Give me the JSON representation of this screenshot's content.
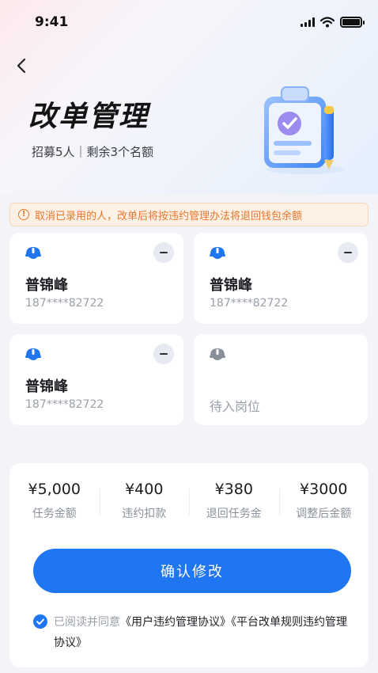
{
  "status_bar": {
    "time": "9:41"
  },
  "header": {
    "title": "改单管理",
    "subtitle": "招募5人｜剩余3个名额"
  },
  "notice": {
    "icon": "info-icon",
    "text": "取消已录用的人，改单后将按违约管理办法将退回钱包余额",
    "color": "#e8772e"
  },
  "workers": [
    {
      "name": "普锦峰",
      "phone": "187****82722",
      "icon": "helmet-icon"
    },
    {
      "name": "普锦峰",
      "phone": "187****82722",
      "icon": "helmet-icon"
    },
    {
      "name": "普锦峰",
      "phone": "187****82722",
      "icon": "helmet-icon"
    }
  ],
  "pending_slot": {
    "text": "待入岗位",
    "icon": "helmet-icon"
  },
  "summary": {
    "items": [
      {
        "value": "¥5,000",
        "label": "任务金额"
      },
      {
        "value": "¥400",
        "label": "违约扣款"
      },
      {
        "value": "¥380",
        "label": "退回任务金"
      },
      {
        "value": "¥3000",
        "label": "调整后金额"
      }
    ],
    "confirm_label": "确认修改",
    "agreement_prefix": "已阅读并同意",
    "agreement_link_1": "《用户违约管理协议》",
    "agreement_link_2": "《平台改单规则违约管理协议》"
  },
  "colors": {
    "primary": "#1f76f0",
    "warning": "#e8772e",
    "helmet_active": "#1f76f0",
    "helmet_inactive": "#8a9099"
  }
}
